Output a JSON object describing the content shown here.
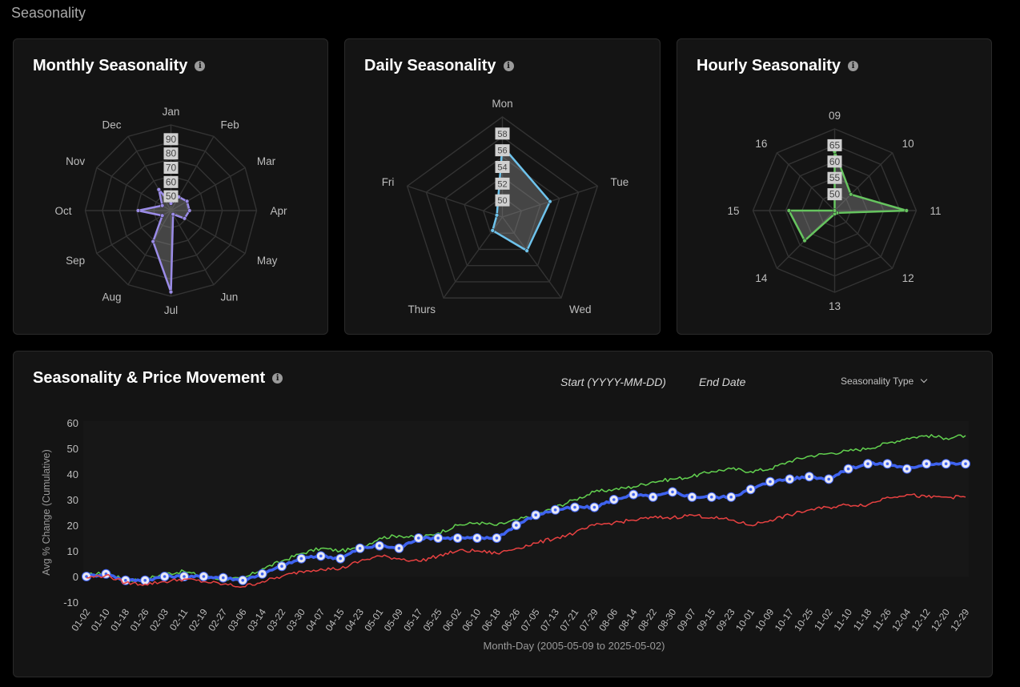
{
  "page": {
    "title": "Seasonality"
  },
  "cards": {
    "monthly": {
      "title": "Monthly Seasonality"
    },
    "daily": {
      "title": "Daily Seasonality"
    },
    "hourly": {
      "title": "Hourly Seasonality"
    },
    "movement": {
      "title": "Seasonality & Price Movement",
      "start_placeholder": "Start (YYYY-MM-DD)",
      "end_placeholder": "End Date",
      "seasonality_type_label": "Seasonality Type"
    }
  },
  "icons": {
    "info": "info-icon",
    "dropdown": "chevron-down-icon"
  },
  "colors": {
    "monthly": "#9b8ce8",
    "daily": "#6ec3ec",
    "hourly": "#66c45f",
    "avg": "#3f63f0",
    "upper": "#62d14f",
    "lower": "#e74141"
  },
  "chart_data": [
    {
      "type": "radar",
      "title": "Monthly Seasonality",
      "categories": [
        "Jan",
        "Feb",
        "Mar",
        "Apr",
        "May",
        "Jun",
        "Jul",
        "Aug",
        "Sep",
        "Oct",
        "Nov",
        "Dec"
      ],
      "values": [
        45,
        51,
        53,
        53,
        51,
        43,
        97,
        65,
        47,
        63,
        47,
        57
      ],
      "range": [
        40,
        100
      ],
      "tick_labels": [
        "50",
        "60",
        "70",
        "80",
        "90"
      ]
    },
    {
      "type": "radar",
      "title": "Daily Seasonality",
      "categories": [
        "Mon",
        "Tue",
        "Wed",
        "Thurs",
        "Fri"
      ],
      "values": [
        56.5,
        54.0,
        53.0,
        50.0,
        48.7
      ],
      "range": [
        48,
        60
      ],
      "tick_labels": [
        "50",
        "52",
        "54",
        "56",
        "58"
      ]
    },
    {
      "type": "radar",
      "title": "Hourly Seasonality",
      "categories": [
        "09",
        "10",
        "11",
        "12",
        "13",
        "14",
        "15",
        "16"
      ],
      "values": [
        63,
        52,
        67,
        46,
        46,
        58,
        59,
        45
      ],
      "range": [
        45,
        70
      ],
      "tick_labels": [
        "50",
        "55",
        "60",
        "65"
      ]
    },
    {
      "type": "line",
      "title": "Seasonality & Price Movement",
      "xlabel": "Month-Day (2005-05-09 to 2025-05-02)",
      "ylabel": "Avg % Change (Cumulative)",
      "ylim": [
        -10,
        60
      ],
      "yticks": [
        -10,
        0,
        10,
        20,
        30,
        40,
        50,
        60
      ],
      "categories": [
        "01-02",
        "01-10",
        "01-18",
        "01-26",
        "02-03",
        "02-11",
        "02-19",
        "02-27",
        "03-06",
        "03-14",
        "03-22",
        "03-30",
        "04-07",
        "04-15",
        "04-23",
        "05-01",
        "05-09",
        "05-17",
        "05-25",
        "06-02",
        "06-10",
        "06-18",
        "06-26",
        "07-05",
        "07-13",
        "07-21",
        "07-29",
        "08-06",
        "08-14",
        "08-22",
        "08-30",
        "09-07",
        "09-15",
        "09-23",
        "10-01",
        "10-09",
        "10-17",
        "10-25",
        "11-02",
        "11-10",
        "11-18",
        "11-26",
        "12-04",
        "12-12",
        "12-20",
        "12-29"
      ],
      "series": [
        {
          "key": "upper",
          "values": [
            0.5,
            1.5,
            -1.5,
            -1,
            1,
            2,
            0,
            -1,
            -1,
            3,
            6,
            9,
            11,
            10,
            11,
            15,
            16,
            15,
            17,
            20,
            21,
            20,
            22,
            24,
            27,
            30,
            33,
            34,
            35,
            37,
            38,
            39,
            41,
            42,
            41,
            42,
            45,
            47,
            48,
            49,
            50,
            52,
            54,
            55,
            54,
            55
          ]
        },
        {
          "key": "avg",
          "values": [
            0,
            1,
            -1.5,
            -1.5,
            0,
            0,
            0,
            -0.5,
            -1.5,
            1,
            4,
            7,
            8,
            7,
            11,
            12,
            11,
            15,
            15,
            15,
            15,
            15,
            20,
            24,
            26,
            27,
            27,
            30,
            32,
            31,
            33,
            31,
            31,
            31,
            34,
            37,
            38,
            39,
            38,
            42,
            44,
            44,
            42,
            44,
            44,
            44
          ]
        },
        {
          "key": "lower",
          "values": [
            -0.5,
            0.5,
            -2.5,
            -3,
            -2,
            -1,
            -2,
            -3,
            -4,
            -2,
            0,
            2,
            3,
            3,
            6,
            8,
            7,
            6,
            8,
            10,
            10,
            9,
            11,
            13,
            15,
            17,
            20,
            21,
            22,
            23,
            23,
            24,
            23,
            22,
            20,
            22,
            24,
            26,
            27,
            28,
            28,
            31,
            32,
            31,
            31,
            31
          ]
        }
      ]
    }
  ]
}
